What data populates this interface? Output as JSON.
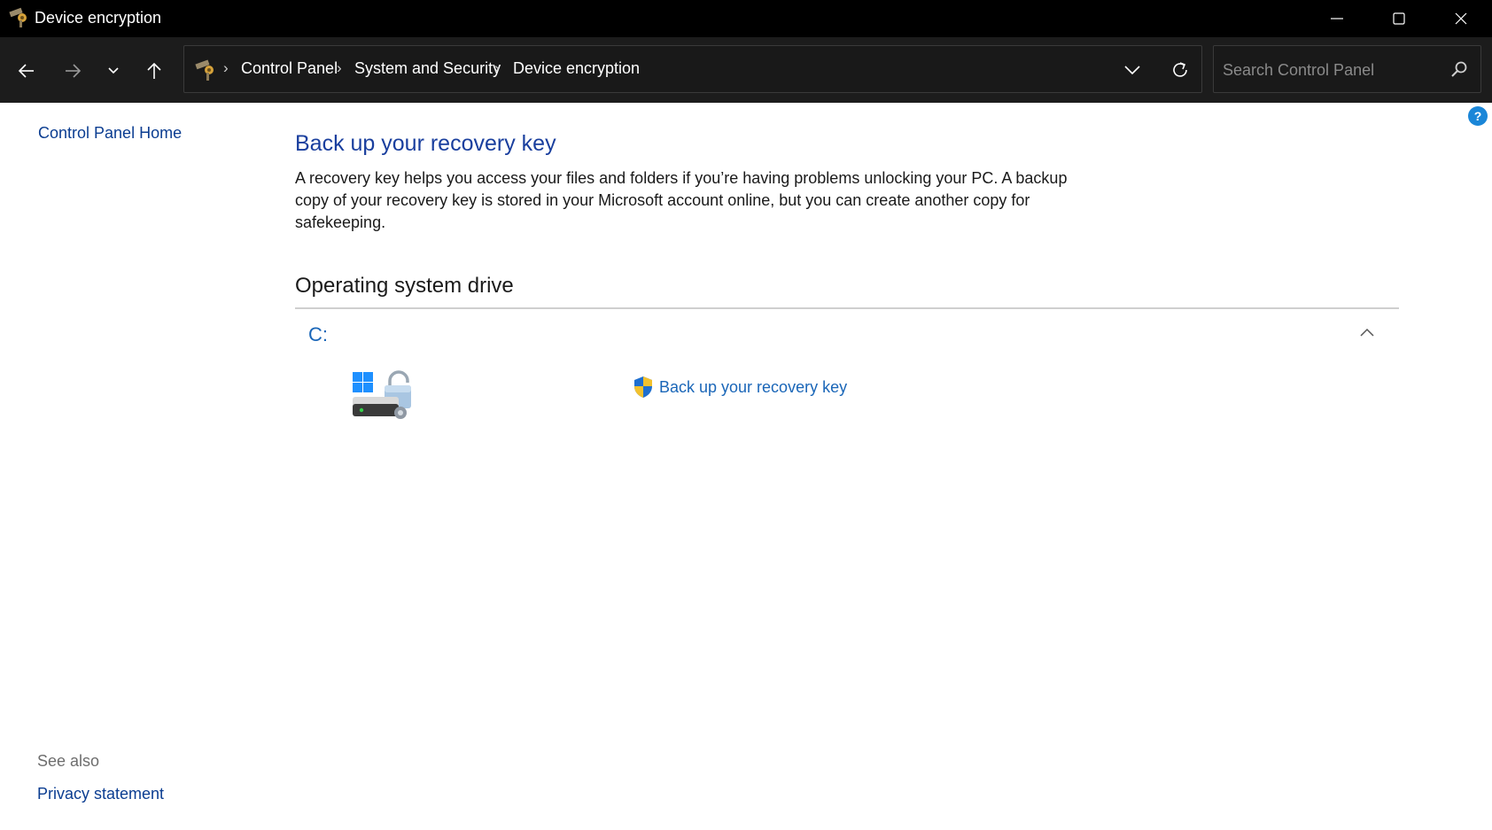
{
  "window": {
    "title": "Device encryption",
    "icon": "control-panel-icon"
  },
  "navigation": {
    "back": "arrow-left-icon",
    "forward": "arrow-right-icon",
    "recent": "chevron-down-icon",
    "up": "arrow-up-icon"
  },
  "address": {
    "breadcrumbs": [
      "Control Panel",
      "System and Security",
      "Device encryption"
    ],
    "separator": "›"
  },
  "search": {
    "placeholder": "Search Control Panel"
  },
  "left_panel": {
    "home_link": "Control Panel Home",
    "see_also_heading": "See also",
    "privacy_link": "Privacy statement"
  },
  "main": {
    "title": "Back up your recovery key",
    "description": "A recovery key helps you access your files and folders if you’re having problems unlocking your PC. A backup copy of your recovery key is stored in your Microsoft account online, but you can create another copy for safekeeping.",
    "section_title": "Operating system drive",
    "drive": {
      "label": "C:",
      "action_link": "Back up your recovery key"
    }
  },
  "colors": {
    "titlebar_bg": "#000000",
    "navbar_bg": "#1c1c1c",
    "heading_blue": "#1a3f9e",
    "link_blue": "#1a66b8",
    "help_blue": "#1a86d8"
  }
}
